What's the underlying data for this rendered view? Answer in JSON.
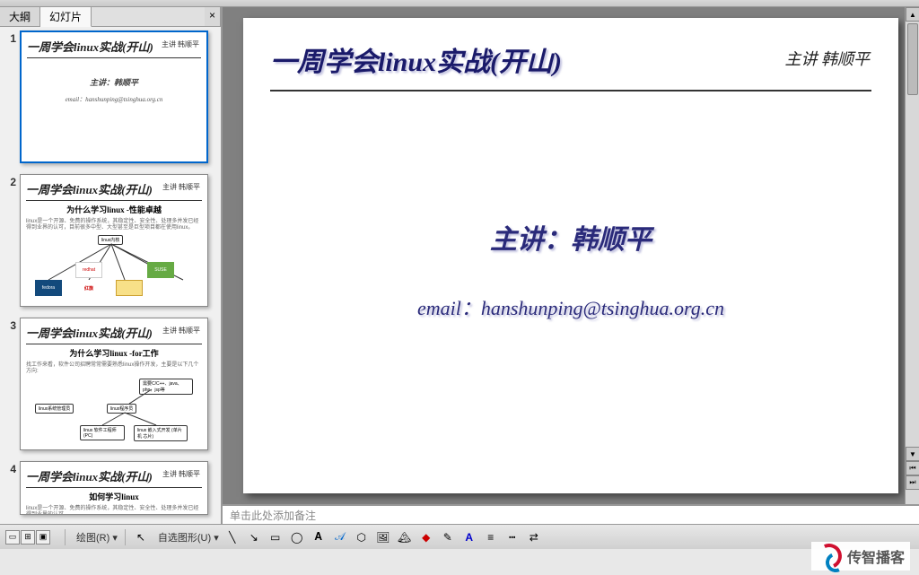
{
  "tabs": {
    "outline": "大綱",
    "slides": "幻灯片"
  },
  "thumbnails": [
    {
      "num": "1",
      "title": "一周学会linux实战(开山)",
      "sub": "主讲 韩顺平",
      "presenter": "主讲：韩顺平",
      "email": "email：hanshunping@tsinghua.org.cn"
    },
    {
      "num": "2",
      "title": "一周学会linux实战(开山)",
      "sub": "主讲 韩顺平",
      "subtitle": "为什么学习linux   -性能卓越",
      "content": "linux是一个开源、免费的操作系统，其稳定性、安全性、处理多并发已经得到业界的认可，目前很多中型、大型甚至是巨型项目都在使用linux。"
    },
    {
      "num": "3",
      "title": "一周学会linux实战(开山)",
      "sub": "主讲 韩顺平",
      "subtitle": "为什么学习linux   -for工作",
      "content": "找工作来看，软件公司招聘常常需要熟悉linux操作开发，主要是以下几个方向:"
    },
    {
      "num": "4",
      "title": "一周学会linux实战(开山)",
      "sub": "主讲 韩顺平",
      "subtitle": "如何学习linux",
      "content": "linux是一个开源、免费的操作系统，其稳定性、安全性、处理多并发已经得到业界的认可..."
    }
  ],
  "main_slide": {
    "title": "一周学会linux实战(开山)",
    "presenter_top": "主讲 韩顺平",
    "presenter": "主讲：韩顺平",
    "email": "email：hanshunping@tsinghua.org.cn"
  },
  "notes_placeholder": "单击此处添加备注",
  "bottom": {
    "draw_label": "绘图(R)",
    "autoshape": "自选图形(U)"
  },
  "watermark": "传智播客",
  "diagram2": {
    "center": "linux内核",
    "logos": {
      "redhat": "redhat",
      "fedora": "fedora",
      "hongqi": "红旗",
      "suse": "SUSE",
      "other": ""
    }
  },
  "diagram3": {
    "n1": "linux系统管理员",
    "n2": "linux程序员",
    "n3": "linux 软件工程师 (PC)",
    "n4": "linux 嵌入式开发 (单片机 芯片)",
    "n5": "需要C/C++、java、php、jsp等"
  }
}
